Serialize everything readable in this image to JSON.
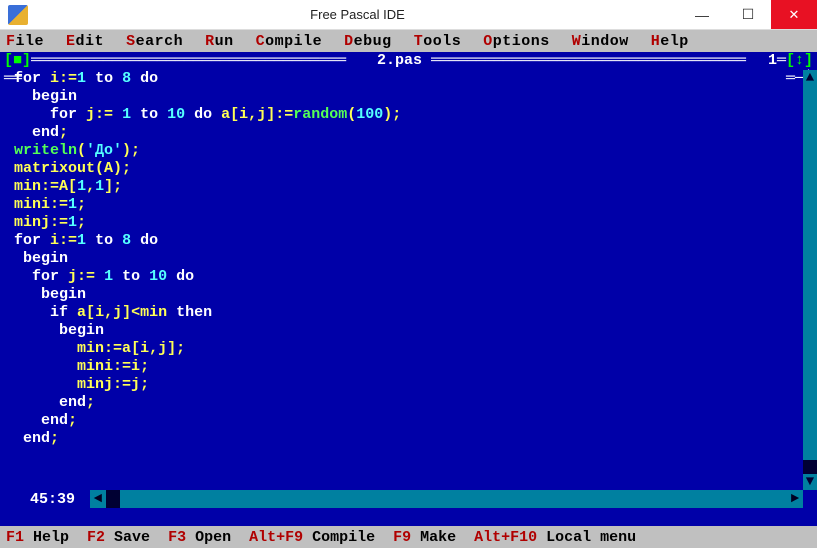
{
  "window": {
    "title": "Free Pascal IDE",
    "min_glyph": "—",
    "max_glyph": "☐",
    "close_glyph": "✕"
  },
  "menu": [
    {
      "hot": "F",
      "rest": "ile"
    },
    {
      "hot": "E",
      "rest": "dit"
    },
    {
      "hot": "S",
      "rest": "earch"
    },
    {
      "hot": "R",
      "rest": "un"
    },
    {
      "hot": "C",
      "rest": "ompile"
    },
    {
      "hot": "D",
      "rest": "ebug"
    },
    {
      "hot": "T",
      "rest": "ools"
    },
    {
      "hot": "O",
      "rest": "ptions"
    },
    {
      "hot": "W",
      "rest": "indow"
    },
    {
      "hot": "H",
      "rest": "elp"
    }
  ],
  "frame": {
    "close_glyph": "[■]",
    "filename": " 2.pas ",
    "win_number": "1",
    "zoom_glyph": "[↕]",
    "top_dash_left": "═══════════════════════════════════",
    "top_dash_right": "═══════════════════════════════════",
    "bot_left": "══",
    "bot_right": "═─┘"
  },
  "code_lines": [
    [
      [
        "kw",
        "for "
      ],
      [
        "id",
        "i"
      ],
      [
        "sym",
        ":="
      ],
      [
        "num",
        "1"
      ],
      [
        "kw",
        " to "
      ],
      [
        "num",
        "8"
      ],
      [
        "kw",
        " do"
      ]
    ],
    [
      [
        "sp",
        "  "
      ],
      [
        "kw",
        "begin"
      ]
    ],
    [
      [
        "sp",
        "    "
      ],
      [
        "kw",
        "for "
      ],
      [
        "id",
        "j"
      ],
      [
        "sym",
        ":= "
      ],
      [
        "num",
        "1"
      ],
      [
        "kw",
        " to "
      ],
      [
        "num",
        "10"
      ],
      [
        "kw",
        " do "
      ],
      [
        "id",
        "a"
      ],
      [
        "sym",
        "["
      ],
      [
        "id",
        "i"
      ],
      [
        "sym",
        ","
      ],
      [
        "id",
        "j"
      ],
      [
        "sym",
        "]:="
      ],
      [
        "fn",
        "random"
      ],
      [
        "sym",
        "("
      ],
      [
        "num",
        "100"
      ],
      [
        "sym",
        ");"
      ]
    ],
    [
      [
        "sp",
        "  "
      ],
      [
        "kw",
        "end"
      ],
      [
        "sym",
        ";"
      ]
    ],
    [
      [
        "fn",
        "writeln"
      ],
      [
        "sym",
        "("
      ],
      [
        "str",
        "'До'"
      ],
      [
        "sym",
        ");"
      ]
    ],
    [
      [
        "id",
        "matrixout"
      ],
      [
        "sym",
        "("
      ],
      [
        "id",
        "A"
      ],
      [
        "sym",
        ");"
      ]
    ],
    [
      [
        "id",
        "min"
      ],
      [
        "sym",
        ":="
      ],
      [
        "id",
        "A"
      ],
      [
        "sym",
        "["
      ],
      [
        "num",
        "1"
      ],
      [
        "sym",
        ","
      ],
      [
        "num",
        "1"
      ],
      [
        "sym",
        "];"
      ]
    ],
    [
      [
        "id",
        "mini"
      ],
      [
        "sym",
        ":="
      ],
      [
        "num",
        "1"
      ],
      [
        "sym",
        ";"
      ]
    ],
    [
      [
        "id",
        "minj"
      ],
      [
        "sym",
        ":="
      ],
      [
        "num",
        "1"
      ],
      [
        "sym",
        ";"
      ]
    ],
    [
      [
        "kw",
        "for "
      ],
      [
        "id",
        "i"
      ],
      [
        "sym",
        ":="
      ],
      [
        "num",
        "1"
      ],
      [
        "kw",
        " to "
      ],
      [
        "num",
        "8"
      ],
      [
        "kw",
        " do"
      ]
    ],
    [
      [
        "sp",
        " "
      ],
      [
        "kw",
        "begin"
      ]
    ],
    [
      [
        "sp",
        "  "
      ],
      [
        "kw",
        "for "
      ],
      [
        "id",
        "j"
      ],
      [
        "sym",
        ":= "
      ],
      [
        "num",
        "1"
      ],
      [
        "kw",
        " to "
      ],
      [
        "num",
        "10"
      ],
      [
        "kw",
        " do"
      ]
    ],
    [
      [
        "sp",
        "   "
      ],
      [
        "kw",
        "begin"
      ]
    ],
    [
      [
        "sp",
        "    "
      ],
      [
        "kw",
        "if "
      ],
      [
        "id",
        "a"
      ],
      [
        "sym",
        "["
      ],
      [
        "id",
        "i"
      ],
      [
        "sym",
        ","
      ],
      [
        "id",
        "j"
      ],
      [
        "sym",
        "]<"
      ],
      [
        "id",
        "min"
      ],
      [
        "kw",
        " then"
      ]
    ],
    [
      [
        "sp",
        "     "
      ],
      [
        "kw",
        "begin"
      ]
    ],
    [
      [
        "sp",
        "       "
      ],
      [
        "id",
        "min"
      ],
      [
        "sym",
        ":="
      ],
      [
        "id",
        "a"
      ],
      [
        "sym",
        "["
      ],
      [
        "id",
        "i"
      ],
      [
        "sym",
        ","
      ],
      [
        "id",
        "j"
      ],
      [
        "sym",
        "];"
      ]
    ],
    [
      [
        "sp",
        "       "
      ],
      [
        "id",
        "mini"
      ],
      [
        "sym",
        ":="
      ],
      [
        "id",
        "i"
      ],
      [
        "sym",
        ";"
      ]
    ],
    [
      [
        "sp",
        "       "
      ],
      [
        "id",
        "minj"
      ],
      [
        "sym",
        ":="
      ],
      [
        "id",
        "j"
      ],
      [
        "sym",
        ";"
      ]
    ],
    [
      [
        "sp",
        "     "
      ],
      [
        "kw",
        "end"
      ],
      [
        "sym",
        ";"
      ]
    ],
    [
      [
        "sp",
        "   "
      ],
      [
        "kw",
        "end"
      ],
      [
        "sym",
        ";"
      ]
    ],
    [
      [
        "sp",
        " "
      ],
      [
        "kw",
        "end"
      ],
      [
        "sym",
        ";"
      ]
    ]
  ],
  "cursor": "45:39",
  "scroll": {
    "left_glyph": "◄",
    "right_glyph": "►",
    "up_glyph": "▲",
    "down_glyph": "▼"
  },
  "status": [
    {
      "key": "F1",
      "label": " Help"
    },
    {
      "key": "F2",
      "label": " Save"
    },
    {
      "key": "F3",
      "label": " Open"
    },
    {
      "key": "Alt+F9",
      "label": " Compile"
    },
    {
      "key": "F9",
      "label": " Make"
    },
    {
      "key": "Alt+F10",
      "label": " Local menu"
    }
  ]
}
